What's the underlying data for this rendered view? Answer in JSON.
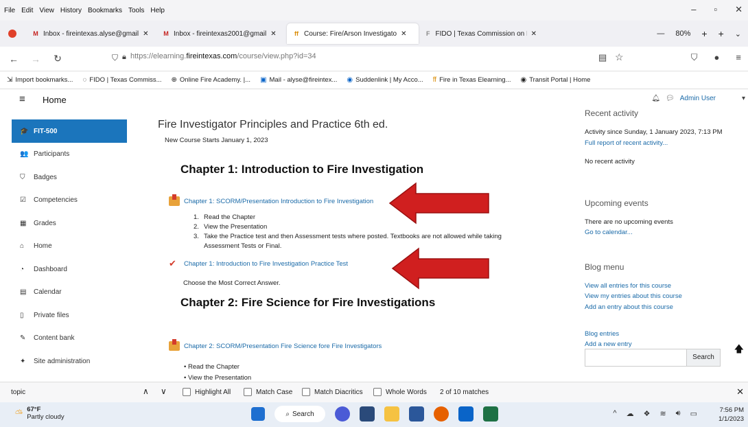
{
  "menu": [
    "File",
    "Edit",
    "View",
    "History",
    "Bookmarks",
    "Tools",
    "Help"
  ],
  "window_controls": [
    "–",
    "▫",
    "✕"
  ],
  "tabs": [
    {
      "icon": "M",
      "label": "Inbox - fireintexas.alyse@gmail",
      "color": "#c5221f"
    },
    {
      "icon": "M",
      "label": "Inbox - fireintexas2001@gmail",
      "color": "#c5221f"
    },
    {
      "icon": "ff",
      "label": "Course: Fire/Arson Investigato",
      "color": "#d98a00"
    },
    {
      "icon": "F",
      "label": "FIDO | Texas Commission on F",
      "color": "#888888"
    }
  ],
  "zoom": {
    "minus": "—",
    "level": "80%",
    "plus": "+",
    "newtab": "+",
    "more": "⌄"
  },
  "url": {
    "prefix": "https://elearning.",
    "host": "fireintexas.com",
    "path": "/course/view.php?id=34"
  },
  "bookmarks": [
    "Import bookmarks...",
    "FIDO | Texas Commiss...",
    "Online Fire Academy. |...",
    "Mail - alyse@fireintex...",
    "Suddenlink | My Acco...",
    "Fire in Texas Elearning...",
    "Transit Portal | Home"
  ],
  "header": {
    "title": "Home",
    "user": "Admin User"
  },
  "sidebar": [
    {
      "label": "FIT-500",
      "icon": "🎓",
      "active": true
    },
    {
      "label": "Participants",
      "icon": "👥"
    },
    {
      "label": "Badges",
      "icon": "⛉"
    },
    {
      "label": "Competencies",
      "icon": "☑"
    },
    {
      "label": "Grades",
      "icon": "▦"
    },
    {
      "label": "Home",
      "icon": "⌂"
    },
    {
      "label": "Dashboard",
      "icon": "◔"
    },
    {
      "label": "Calendar",
      "icon": "▤"
    },
    {
      "label": "Private files",
      "icon": "▯"
    },
    {
      "label": "Content bank",
      "icon": "✎"
    },
    {
      "label": "Site administration",
      "icon": "✦"
    }
  ],
  "main": {
    "course_title": "Fire Investigator Principles and Practice 6th ed.",
    "course_subtitle": "New Course Starts January 1, 2023",
    "chapter1_heading": "Chapter 1:  Introduction to Fire Investigation",
    "chapter1_scorm": "Chapter 1: SCORM/Presentation Introduction to Fire Investigation",
    "steps": [
      {
        "n": "1.",
        "text": "Read the Chapter"
      },
      {
        "n": "2.",
        "text": "View the Presentation"
      },
      {
        "n": "3.",
        "text": "Take the Practice test and then Assessment tests where posted. Textbooks are not allowed while taking Assessment Tests or Final."
      }
    ],
    "chapter1_quiz": "Chapter 1: Introduction to Fire Investigation Practice Test",
    "choose_text": "Choose the Most Correct Answer.",
    "chapter2_heading": "Chapter 2: Fire Science for Fire Investigations",
    "chapter2_scorm": "Chapter 2: SCORM/Presentation Fire Science fore Fire Investigators",
    "bullets": [
      "Read the Chapter",
      "View the Presentation"
    ]
  },
  "right": {
    "recent_heading": "Recent activity",
    "activity_since": "Activity since Sunday, 1 January 2023, 7:13 PM",
    "full_report": "Full report of recent activity...",
    "no_recent": "No recent activity",
    "upcoming_heading": "Upcoming events",
    "no_upcoming": "There are no upcoming events",
    "go_calendar": "Go to calendar...",
    "blog_heading": "Blog menu",
    "blog_view_all": "View all entries for this course",
    "blog_view_mine": "View my entries about this course",
    "blog_add_about": "Add an entry about this course",
    "blog_entries": "Blog entries",
    "add_new_entry": "Add a new entry",
    "search_button": "Search"
  },
  "findbar": {
    "query": "topic",
    "highlight_all": "Highlight All",
    "match_case": "Match Case",
    "match_diacritics": "Match Diacritics",
    "whole_words": "Whole Words",
    "matches": "2 of 10 matches"
  },
  "taskbar": {
    "temp": "67°F",
    "weather": "Partly cloudy",
    "search": "Search",
    "time": "7:56 PM",
    "date": "1/1/2023"
  },
  "colors": {
    "accent": "#1b75bc",
    "link": "#1a6aa8",
    "arrow": "#d01f1f"
  }
}
